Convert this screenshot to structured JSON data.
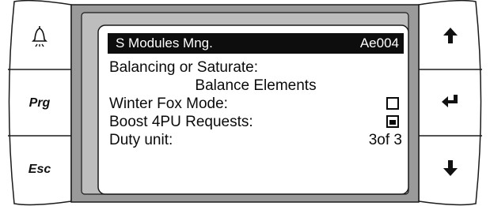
{
  "left_keys": {
    "alarm_icon": "bell-icon",
    "prg_label": "Prg",
    "esc_label": "Esc"
  },
  "right_keys": {
    "up_icon": "arrow-up-icon",
    "enter_icon": "enter-return-icon",
    "down_icon": "arrow-down-icon"
  },
  "screen": {
    "title": "S Modules Mng.",
    "code": "Ae004",
    "rows": [
      {
        "label": "Balancing or Saturate:"
      },
      {
        "value": "Balance Elements"
      },
      {
        "label": "Winter Fox Mode:",
        "checked": false
      },
      {
        "label": "Boost 4PU Requests:",
        "checked": true
      },
      {
        "label": "Duty unit:",
        "value": "3of 3"
      }
    ]
  },
  "colors": {
    "frame": "#9a9a9a",
    "bezel": "#bdbdbd",
    "screen_bg": "#ffffff",
    "title_bar": "#0d0d0d"
  }
}
